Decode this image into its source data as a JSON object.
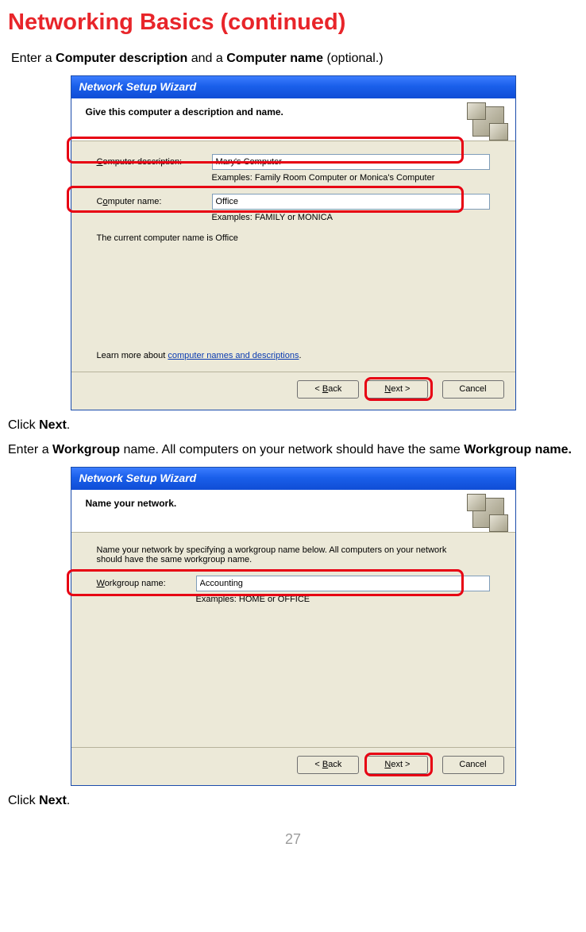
{
  "page": {
    "title": "Networking Basics (continued)",
    "number": "27",
    "instr1_pre": "Enter a ",
    "instr1_b1": "Computer description",
    "instr1_mid": " and a ",
    "instr1_b2": "Computer name",
    "instr1_post": " (optional.)",
    "click_next_pre": "Click ",
    "click_next_b": "Next",
    "click_next_post": ".",
    "instr2_pre": "Enter a ",
    "instr2_b1": "Workgroup",
    "instr2_mid": " name.  All computers on your network should have the same ",
    "instr2_b2": "Workgroup name."
  },
  "wiz1": {
    "title": "Network Setup Wizard",
    "header": "Give this computer a description and name.",
    "desc_label_u": "C",
    "desc_label_rest": "omputer description:",
    "desc_value": "Mary's Computer",
    "desc_example": "Examples: Family Room Computer or Monica's Computer",
    "name_label_pre1": "C",
    "name_label_u": "o",
    "name_label_rest": "mputer name:",
    "name_value": "Office",
    "name_example": "Examples: FAMILY or MONICA",
    "current": "The current computer name is Office",
    "learn_pre": "Learn more about ",
    "learn_link": "computer names and descriptions",
    "learn_post": ".",
    "back_pre": "< ",
    "back_u": "B",
    "back_rest": "ack",
    "next_u": "N",
    "next_rest": "ext >",
    "cancel": "Cancel"
  },
  "wiz2": {
    "title": "Network Setup Wizard",
    "header": "Name your network.",
    "intro": "Name your network by specifying a workgroup name below. All computers on your network should have the same workgroup name.",
    "wg_label_u": "W",
    "wg_label_rest": "orkgroup name:",
    "wg_value": "Accounting",
    "wg_example": "Examples: HOME or OFFICE",
    "back_pre": "< ",
    "back_u": "B",
    "back_rest": "ack",
    "next_u": "N",
    "next_rest": "ext >",
    "cancel": "Cancel"
  }
}
